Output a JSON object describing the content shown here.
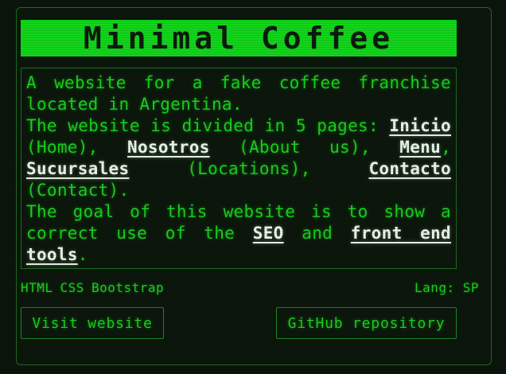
{
  "card": {
    "title": "Minimal Coffee",
    "description": {
      "p1": "A website for a fake coffee franchise located in Argentina.",
      "p2": {
        "prefix": "The website is divided in 5 pages: ",
        "link_inicio": "Inicio",
        "after_inicio": " (Home), ",
        "link_nosotros": "Nosotros",
        "after_nosotros": " (About us), ",
        "link_menu": "Menu",
        "after_menu": ", ",
        "link_sucursales": "Sucursales",
        "after_sucursales": " (Locations), ",
        "link_contacto": "Contacto",
        "after_contacto": " (Contact)."
      },
      "p3": {
        "prefix": "The goal of this website is to show a correct use of the ",
        "link_seo": "SEO",
        "middle": " and ",
        "link_tools": "front end tools",
        "suffix": "."
      }
    },
    "tech": [
      "HTML",
      "CSS",
      "Bootstrap"
    ],
    "lang": "Lang: SP",
    "buttons": {
      "visit": "Visit website",
      "github": "GitHub repository"
    }
  },
  "colors": {
    "background": "#0b150b",
    "accent_green": "#12d61b",
    "text_green": "#19d21d",
    "link_white": "#e9fbe9",
    "border_green": "#1f6b24"
  }
}
